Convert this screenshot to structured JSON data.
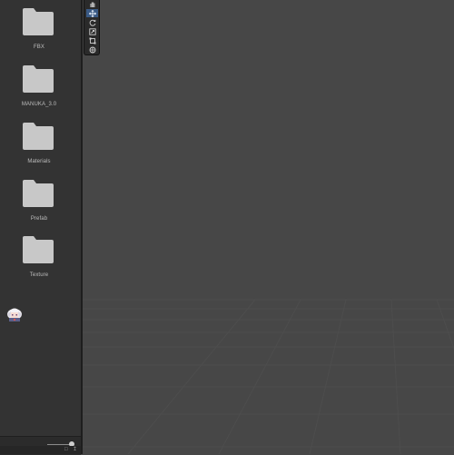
{
  "project": {
    "folders": [
      {
        "label": "FBX"
      },
      {
        "label": "MANUKA_3.0"
      },
      {
        "label": "Materials"
      },
      {
        "label": "Prefab"
      },
      {
        "label": "Texture"
      }
    ],
    "thumbnail_asset": {
      "icon": "character-thumbnail-icon"
    },
    "footer": {
      "icons": [
        "lock-icon",
        "counter-icon"
      ]
    }
  },
  "scene": {
    "tools": [
      {
        "name": "hand-tool",
        "icon": "hand-icon",
        "active": false
      },
      {
        "name": "move-tool",
        "icon": "move-icon",
        "active": true
      },
      {
        "name": "rotate-tool",
        "icon": "rotate-icon",
        "active": false
      },
      {
        "name": "scale-tool",
        "icon": "scale-icon",
        "active": false
      },
      {
        "name": "rect-tool",
        "icon": "rect-icon",
        "active": false
      },
      {
        "name": "transform-tool",
        "icon": "transform-icon",
        "active": false
      }
    ]
  },
  "colors": {
    "panel_bg": "#333333",
    "scene_bg": "#474747",
    "folder_icon": "#c8c8c8",
    "active_tool": "#3a5a85"
  }
}
